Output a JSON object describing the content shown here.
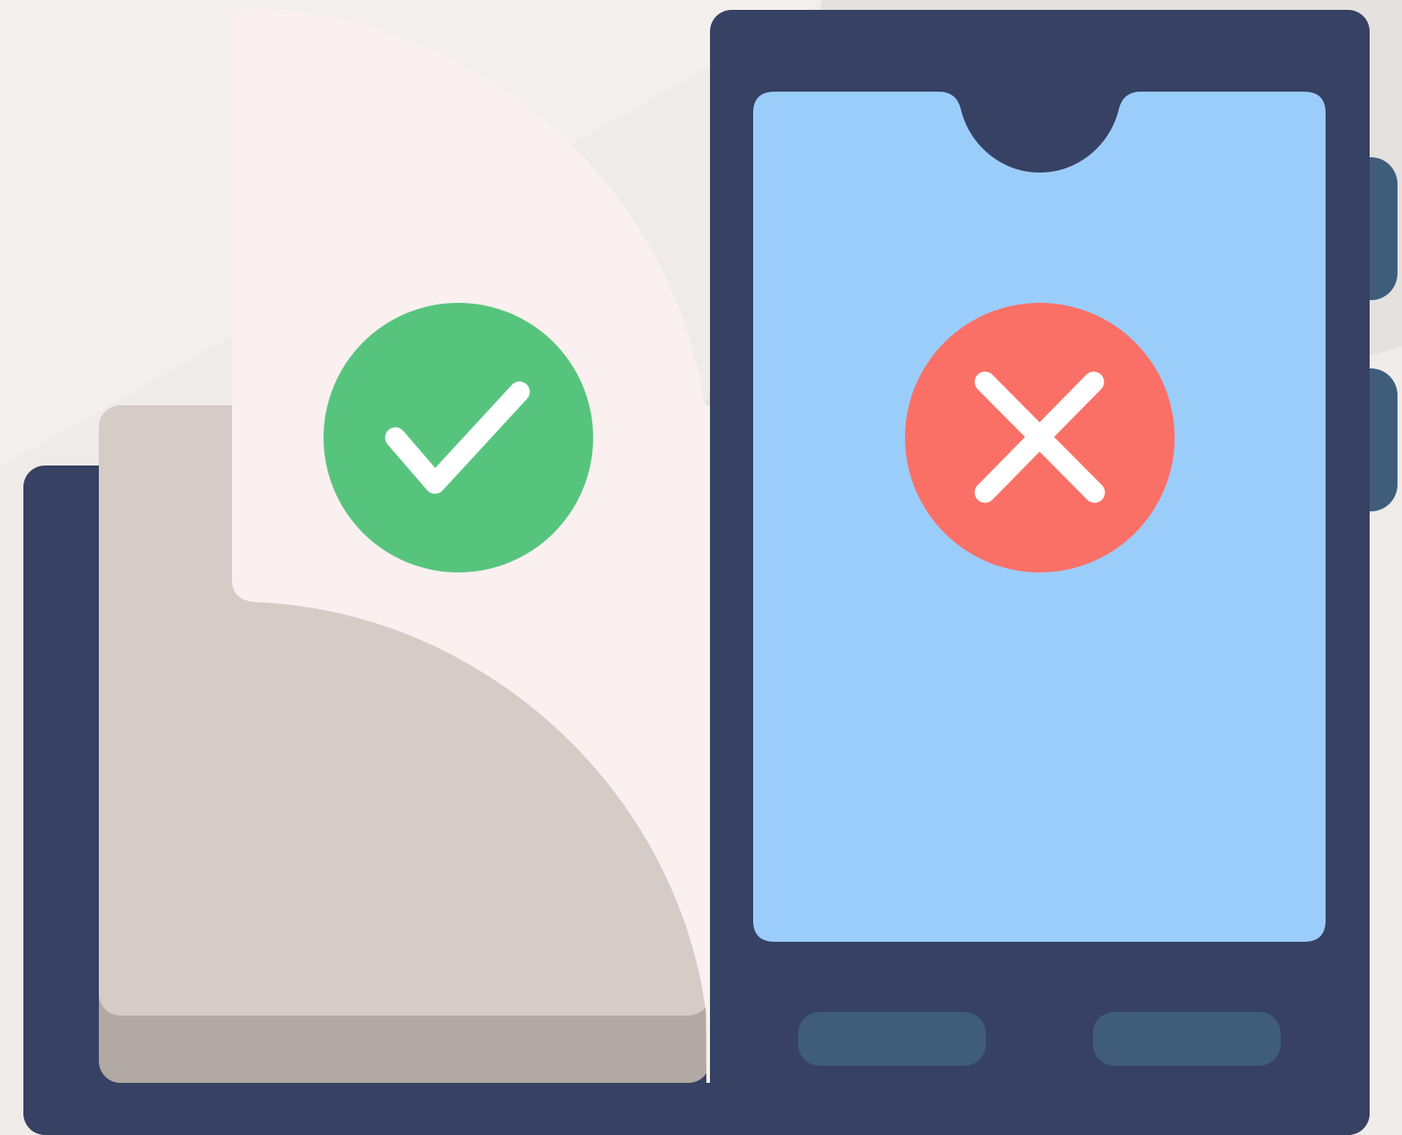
{
  "illustration": {
    "colors": {
      "background": "#efebe8",
      "background_light": "#f3efec",
      "background_shadow": "#e4e1df",
      "device_navy": "#364163",
      "screen_blue": "#9bcdfb",
      "page_front": "#f9f0ef",
      "page_middle": "#d6ccc7",
      "page_back": "#b2a9a4",
      "side_button": "#3f5d7b",
      "approve_green": "#57c47e",
      "reject_red": "#fa7066",
      "mark_white": "#ffffff"
    },
    "elements": {
      "approve": {
        "icon": "check-icon",
        "meaning": "approved"
      },
      "reject": {
        "icon": "x-icon",
        "meaning": "rejected"
      },
      "phone": {
        "icon": "smartphone-icon"
      },
      "document": {
        "icon": "book-icon"
      }
    }
  }
}
